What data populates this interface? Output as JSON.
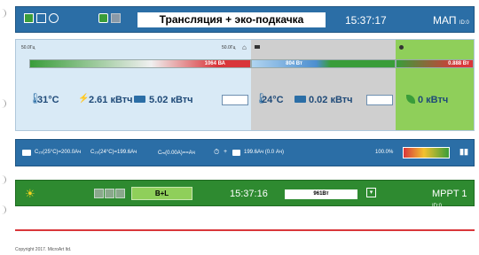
{
  "header": {
    "title": "Трансляция + эко-подкачка",
    "time": "15:37:17",
    "device": "МАП",
    "device_suffix": "ID:0"
  },
  "main": {
    "grid": {
      "freq_left": "50.0Гц",
      "freq_right": "50.0Гц",
      "bar_value": "1064 ВА",
      "temp": "31°C",
      "power1": "2.61 кВтч",
      "power2": "5.02 кВтч"
    },
    "inverter": {
      "bar_value": "804 Вт",
      "temp": "24°C",
      "power": "0.02 кВтч"
    },
    "eco": {
      "bar_value": "0.888 Вт",
      "power": "0 кВтч"
    }
  },
  "battery": {
    "c25": "C₂₀(25°C)=200.0Ач",
    "c24": "C₂₀(24°C)=199.6Ач",
    "current": "Cₘ(0.00A)==Ач",
    "charge": "199.6Ач (0.0 Ач)",
    "percent": "100.0%",
    "level": 1.0
  },
  "mppt": {
    "mode": "В+L",
    "time": "15:37:16",
    "power": "961Вт",
    "device": "MPPT 1",
    "device_suffix": "ID:0"
  },
  "footer": {
    "copyright": "Copyright 2017. MicroArt ltd."
  },
  "colors": {
    "header_blue": "#2b6ea6",
    "mppt_green": "#2e8a30",
    "accent_red": "#d9363a"
  }
}
